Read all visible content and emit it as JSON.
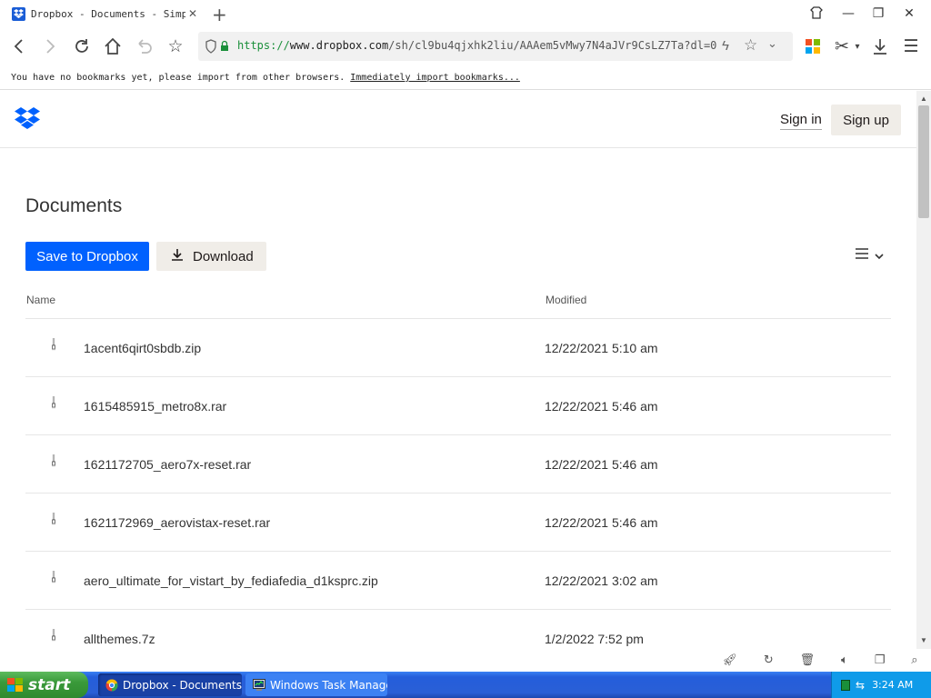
{
  "browser": {
    "tab_title": "Dropbox - Documents - Simp",
    "url_scheme": "https://",
    "url_host": "www.dropbox.com",
    "url_path": "/sh/cl9bu4qjxhk2liu/AAAem5vMwy7N4aJVr9CsLZ7Ta?dl=0",
    "bookmark_message": "You have no bookmarks yet, please import from other browsers.",
    "bookmark_link": "Immediately import bookmarks..."
  },
  "header": {
    "signin_label": "Sign in",
    "signup_label": "Sign up"
  },
  "main": {
    "title": "Documents",
    "save_label": "Save to Dropbox",
    "download_label": "Download",
    "columns": {
      "name": "Name",
      "modified": "Modified"
    },
    "files": [
      {
        "name": "1acent6qirt0sbdb.zip",
        "modified": "12/22/2021 5:10 am"
      },
      {
        "name": "1615485915_metro8x.rar",
        "modified": "12/22/2021 5:46 am"
      },
      {
        "name": "1621172705_aero7x-reset.rar",
        "modified": "12/22/2021 5:46 am"
      },
      {
        "name": "1621172969_aerovistax-reset.rar",
        "modified": "12/22/2021 5:46 am"
      },
      {
        "name": "aero_ultimate_for_vistart_by_fediafedia_d1ksprc.zip",
        "modified": "12/22/2021 3:02 am"
      },
      {
        "name": "allthemes.7z",
        "modified": "1/2/2022 7:52 pm"
      }
    ]
  },
  "taskbar": {
    "start_label": "start",
    "task1": "Dropbox - Documents...",
    "task2": "Windows Task Manager",
    "clock": "3:24 AM"
  },
  "colors": {
    "dropbox_blue": "#0061fe",
    "button_beige": "#f0ede8",
    "xp_taskbar": "#245edb",
    "xp_start_green": "#3a9a3a"
  }
}
